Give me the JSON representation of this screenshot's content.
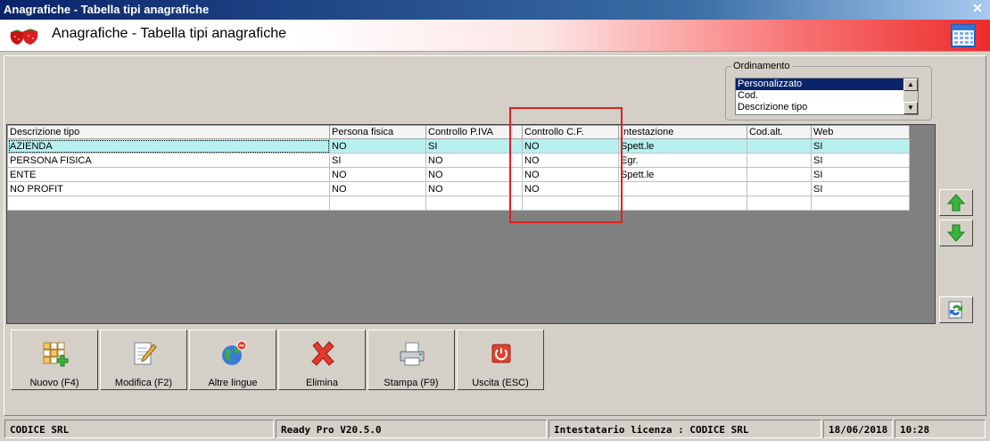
{
  "window": {
    "title": "Anagrafiche - Tabella tipi anagrafiche"
  },
  "header": {
    "title": "Anagrafiche - Tabella tipi anagrafiche"
  },
  "ordinamento": {
    "label": "Ordinamento",
    "options": [
      "Personalizzato",
      "Cod.",
      "Descrizione tipo"
    ],
    "selected": "Personalizzato"
  },
  "grid": {
    "columns": [
      "Descrizione tipo",
      "Persona fisica",
      "Controllo P.IVA",
      "Controllo C.F.",
      "Intestazione",
      "Cod.alt.",
      "Web"
    ],
    "rows": [
      [
        "AZIENDA",
        "NO",
        "SI",
        "NO",
        "Spett.le",
        "",
        "SI"
      ],
      [
        "PERSONA FISICA",
        "SI",
        "NO",
        "NO",
        "Egr.",
        "",
        "SI"
      ],
      [
        "ENTE",
        "NO",
        "NO",
        "NO",
        "Spett.le",
        "",
        "SI"
      ],
      [
        "NO PROFIT",
        "NO",
        "NO",
        "NO",
        "",
        "",
        "SI"
      ]
    ]
  },
  "toolbar": {
    "nuovo": "Nuovo (F4)",
    "modifica": "Modifica (F2)",
    "altre_lingue": "Altre lingue",
    "elimina": "Elimina",
    "stampa": "Stampa (F9)",
    "uscita": "Uscita (ESC)"
  },
  "status": {
    "company": "CODICE SRL",
    "version": "Ready Pro V20.5.0",
    "license": "Intestatario licenza : CODICE SRL",
    "date": "18/06/2018",
    "time": "10:28"
  },
  "colors": {
    "accent_red": "#e02020",
    "selected_row": "#b8f0f0",
    "titlebar": "#0a246a"
  }
}
